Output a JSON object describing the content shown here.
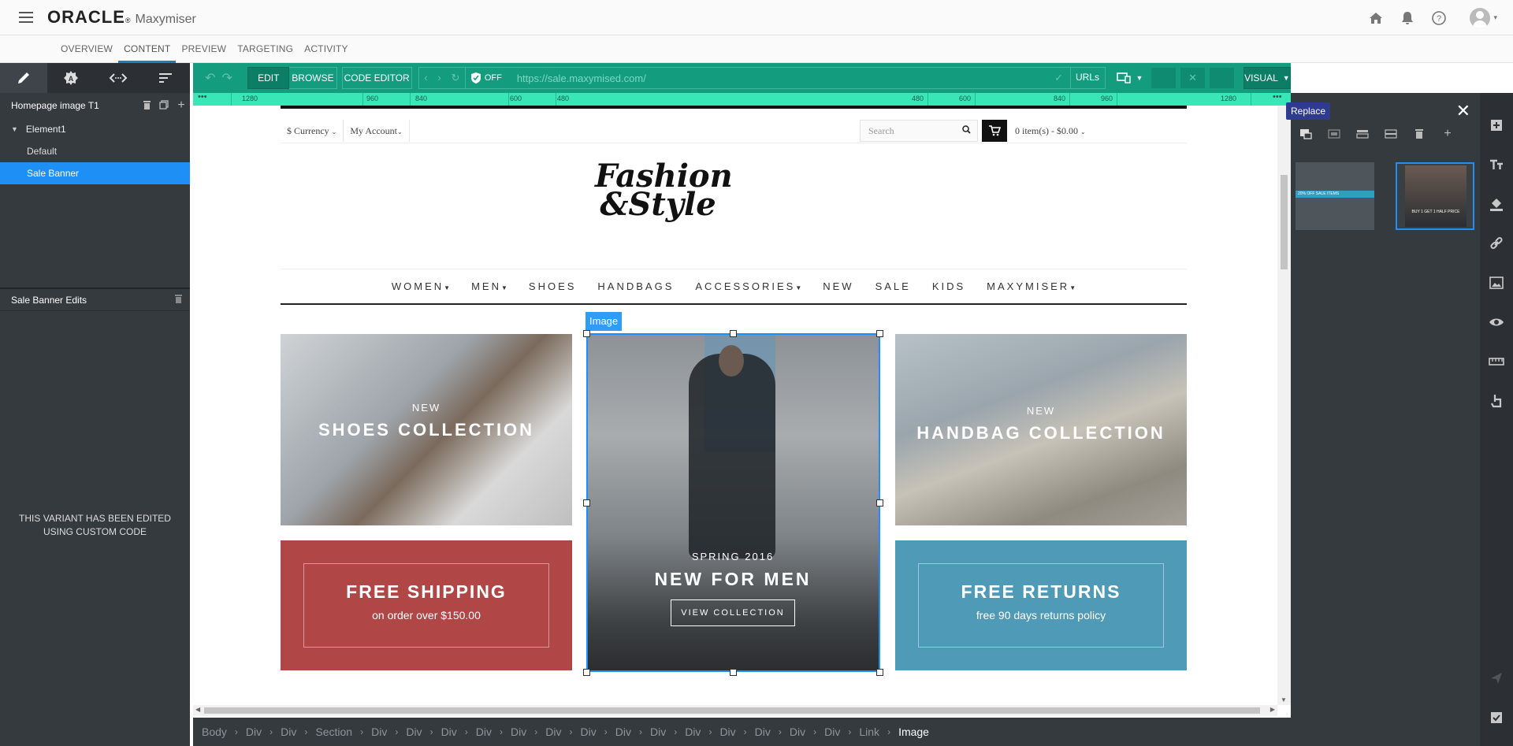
{
  "header": {
    "brand": "ORACLE",
    "brand_mark": "®",
    "product": "Maxymiser",
    "icons": [
      "menu-icon",
      "home-icon",
      "bell-icon",
      "help-icon",
      "user-avatar-icon"
    ]
  },
  "nav": {
    "tabs": [
      "OVERVIEW",
      "CONTENT",
      "PREVIEW",
      "TARGETING",
      "ACTIVITY"
    ],
    "active": "CONTENT"
  },
  "left_panel": {
    "tools": [
      "pencil-icon",
      "palette-icon",
      "code-arrows-icon",
      "sort-icon"
    ],
    "campaign_title": "Homepage image T1",
    "element": "Element1",
    "variants": [
      "Default",
      "Sale Banner"
    ],
    "selected_variant": "Sale Banner",
    "edits_title": "Sale Banner Edits",
    "message_line1": "THIS VARIANT HAS BEEN EDITED",
    "message_line2": "USING CUSTOM CODE"
  },
  "toolbar": {
    "edit": "EDIT",
    "browse": "BROWSE",
    "code_editor": "CODE EDITOR",
    "shield_status": "OFF",
    "url": "https://sale.maxymised.com/",
    "urls": "URLs",
    "visual": "VISUAL"
  },
  "ruler": {
    "left_labels": [
      "1280",
      "960",
      "840",
      "600",
      "480"
    ],
    "right_labels": [
      "480",
      "600",
      "840",
      "960",
      "1280"
    ]
  },
  "site": {
    "currency": "$ Currency",
    "account": "My Account",
    "search_placeholder": "Search",
    "cart": "0  item(s) - $0.00",
    "logo_line1": "Fashion",
    "logo_line2": "&Style",
    "menu": [
      "WOMEN",
      "MEN",
      "SHOES",
      "HANDBAGS",
      "ACCESSORIES",
      "NEW",
      "SALE",
      "KIDS",
      "MAXYMISER"
    ],
    "menu_dropdowns": [
      true,
      true,
      false,
      false,
      true,
      false,
      false,
      false,
      true
    ],
    "shoes_small": "NEW",
    "shoes_big": "SHOES COLLECTION",
    "hand_small": "NEW",
    "hand_big": "HANDBAG COLLECTION",
    "ship_title": "FREE SHIPPING",
    "ship_sub": "on order over $150.00",
    "ret_title": "FREE RETURNS",
    "ret_sub": "free 90 days returns policy",
    "men_small": "SPRING 2016",
    "men_big": "NEW FOR MEN",
    "men_button": "VIEW COLLECTION"
  },
  "selection": {
    "tag": "Image"
  },
  "breadcrumb": [
    "Body",
    "Div",
    "Div",
    "Section",
    "Div",
    "Div",
    "Div",
    "Div",
    "Div",
    "Div",
    "Div",
    "Div",
    "Div",
    "Div",
    "Div",
    "Div",
    "Div",
    "Div",
    "Link",
    "Image"
  ],
  "right_panel": {
    "tooltip": "Replace",
    "tools": [
      "replace-image-icon",
      "image-frame-icon",
      "align-top-icon",
      "align-middle-icon",
      "trash-icon",
      "plus-icon"
    ],
    "thumb_a_text": "20% OFF  SALE ITEMS",
    "thumb_b_text": "BUY 1 GET 1 HALF PRICE"
  },
  "right_rail": [
    "add-icon",
    "text-icon",
    "paint-bucket-icon",
    "link-icon",
    "image-icon",
    "eye-icon",
    "ruler-icon",
    "touch-icon",
    "send-icon",
    "checkbox-icon"
  ]
}
